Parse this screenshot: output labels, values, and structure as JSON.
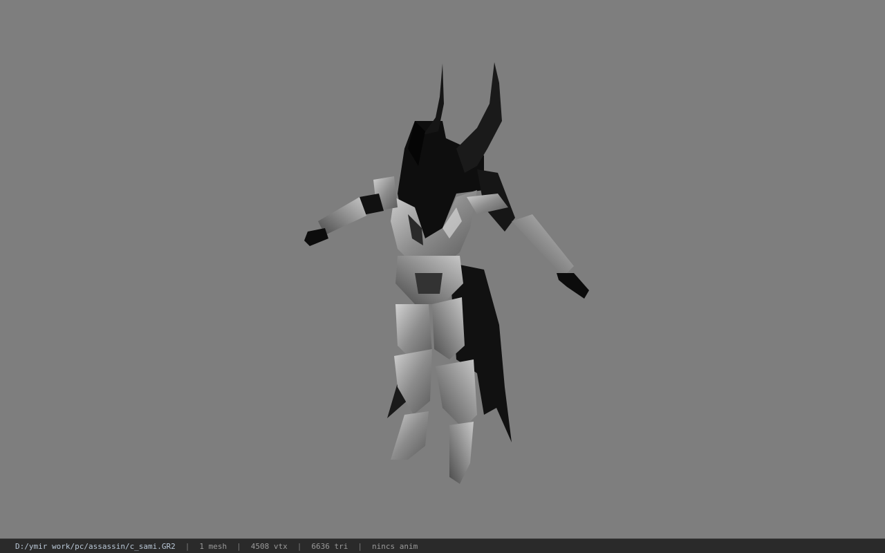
{
  "viewport": {
    "background": "#7e7e7e",
    "model": "armored-character-tpose"
  },
  "statusbar": {
    "file_path": "D:/ymir work/pc/assassin/c_sami.GR2",
    "separator": "|",
    "mesh_count": "1 mesh",
    "vertex_count": "4508 vtx",
    "triangle_count": "6636 tri",
    "anim_status": "nincs anim"
  }
}
